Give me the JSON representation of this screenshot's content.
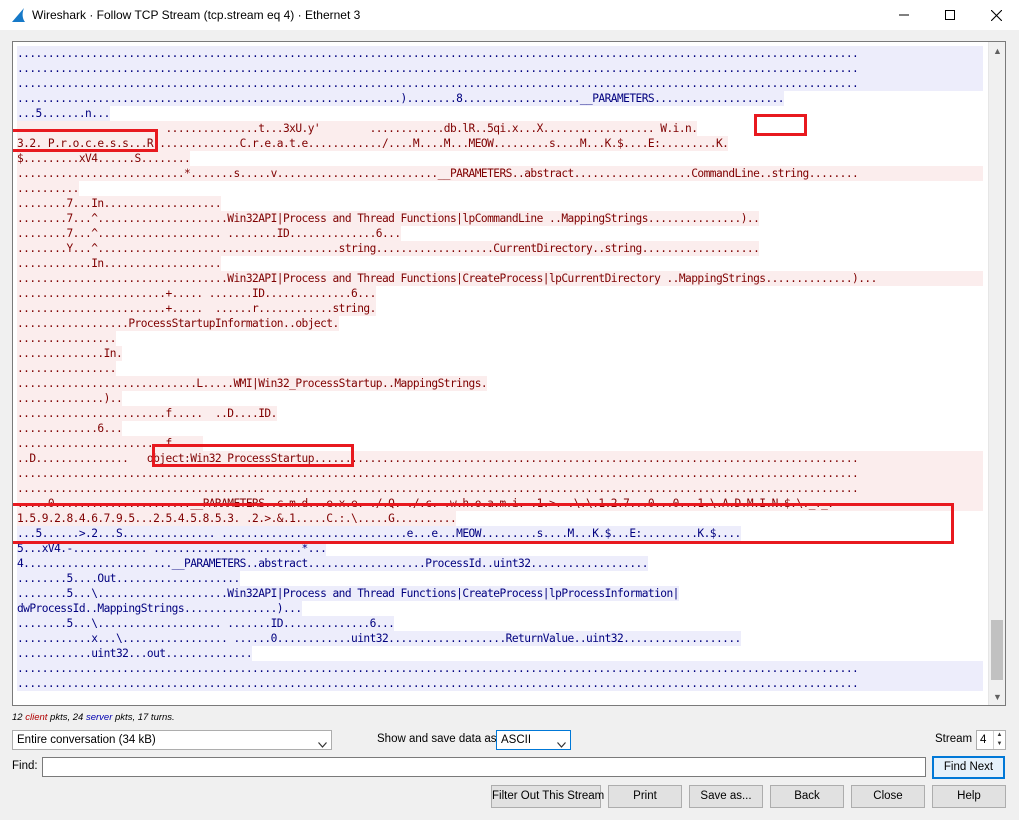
{
  "window": {
    "title": "Wireshark · Follow TCP Stream (tcp.stream eq 4) · Ethernet 3",
    "minimize_icon": "minimize-icon",
    "maximize_icon": "maximize-icon",
    "close_icon": "close-icon"
  },
  "colors": {
    "client_bg": "#fbeded",
    "client_fg": "#7f0000",
    "server_bg": "#ededfb",
    "server_fg": "#00007f",
    "highlight": "#e8191f"
  },
  "stream_lines": [
    {
      "side": "server",
      "full": true,
      "text": "........................................................................................................................................"
    },
    {
      "side": "server",
      "full": true,
      "text": "........................................................................................................................................"
    },
    {
      "side": "server",
      "full": true,
      "text": "........................................................................................................................................"
    },
    {
      "side": "server",
      "full": false,
      "text": "..............................................................)........8...................__PARAMETERS....................."
    },
    {
      "side": "server",
      "full": false,
      "text": "...5.......n..."
    },
    {
      "side": "client",
      "full": false,
      "text": "..................      ...............t...3xU.y'        ............db.lR..5qi.x...X.................. W.i.n."
    },
    {
      "side": "client",
      "full": false,
      "text": "3.2._P.r.o.c.e.s.s...R..............C.r.e.a.t.e............/....M....M...MEOW.........s....M...K.$....E:.........K."
    },
    {
      "side": "client",
      "full": false,
      "text": "$.........xV4......S........"
    },
    {
      "side": "client",
      "full": true,
      "text": "...........................*.......s.....v..........................__PARAMETERS..abstract...................CommandLine..string........"
    },
    {
      "side": "client",
      "full": false,
      "text": ".........."
    },
    {
      "side": "client",
      "full": false,
      "text": "........7...In..................."
    },
    {
      "side": "client",
      "full": false,
      "text": "........7...^.....................Win32API|Process and Thread Functions|lpCommandLine ..MappingStrings...............).."
    },
    {
      "side": "client",
      "full": false,
      "text": "........7...^.................... ........ID..............6..."
    },
    {
      "side": "client",
      "full": false,
      "text": "........Y...^.......................................string...................CurrentDirectory..string..................."
    },
    {
      "side": "client",
      "full": false,
      "text": "............In..................."
    },
    {
      "side": "client",
      "full": true,
      "text": "..................................Win32API|Process and Thread Functions|CreateProcess|lpCurrentDirectory ..MappingStrings..............)..."
    },
    {
      "side": "client",
      "full": false,
      "text": "........................+..... .......ID..............6..."
    },
    {
      "side": "client",
      "full": false,
      "text": "........................+.....  ......r............string."
    },
    {
      "side": "client",
      "full": false,
      "text": "..................ProcessStartupInformation..object."
    },
    {
      "side": "client",
      "full": false,
      "text": "................"
    },
    {
      "side": "client",
      "full": false,
      "text": "..............In."
    },
    {
      "side": "client",
      "full": false,
      "text": "................"
    },
    {
      "side": "client",
      "full": false,
      "text": ".............................L.....WMI|Win32_ProcessStartup..MappingStrings."
    },
    {
      "side": "client",
      "full": false,
      "text": "..............).."
    },
    {
      "side": "client",
      "full": false,
      "text": "........................f.....  ..D....ID."
    },
    {
      "side": "client",
      "full": false,
      "text": ".............6..."
    },
    {
      "side": "client",
      "full": false,
      "text": "........................f....."
    },
    {
      "side": "client",
      "full": true,
      "text": "..D...............   object:Win32_ProcessStartup........................................................................................"
    },
    {
      "side": "client",
      "full": true,
      "text": "........................................................................................................................................"
    },
    {
      "side": "client",
      "full": true,
      "text": "........................................................................................................................................"
    },
    {
      "side": "client",
      "full": true,
      "text": ".....0......................__PARAMETERS..c.m.d...e.x.e. ./.Q. ./.c. .w.h.o.a.m.i. .1.>. .\\.\\.1.2.7...0...0...1.\\.A.D.M.I.N.$.\\._._."
    },
    {
      "side": "client",
      "full": false,
      "text": "1.5.9.2.8.4.6.7.9.5...2.5.4.5.8.5.3. .2.>.&.1.....C.:.\\.....G.........."
    },
    {
      "side": "server",
      "full": false,
      "text": "...5......>.2...S............... ..............................e...e...MEOW.........s....M...K.$...E:.........K.$...."
    },
    {
      "side": "server",
      "full": false,
      "text": "5...xV4.-............ ........................*..."
    },
    {
      "side": "server",
      "full": false,
      "text": "4........................__PARAMETERS..abstract...................ProcessId..uint32..................."
    },
    {
      "side": "server",
      "full": false,
      "text": "........5....Out...................."
    },
    {
      "side": "server",
      "full": false,
      "text": "........5...\\.....................Win32API|Process and Thread Functions|CreateProcess|lpProcessInformation|"
    },
    {
      "side": "server",
      "full": false,
      "text": "dwProcessId..MappingStrings...............)..."
    },
    {
      "side": "server",
      "full": false,
      "text": "........5...\\.................... .......ID..............6..."
    },
    {
      "side": "server",
      "full": false,
      "text": "............x...\\................. ......0............uint32...................ReturnValue..uint32..................."
    },
    {
      "side": "server",
      "full": false,
      "text": "............uint32...out.............."
    },
    {
      "side": "server",
      "full": true,
      "text": "........................................................................................................................................"
    },
    {
      "side": "server",
      "full": true,
      "text": "........................................................................................................................................"
    }
  ],
  "scroll": {
    "up_icon": "scroll-up-icon",
    "down_icon": "scroll-down-icon"
  },
  "stats": {
    "client_count": "12",
    "client_word": "client",
    "middle": "pkts,",
    "server_count": "24",
    "server_word": "server",
    "tail": "pkts, 17 turns."
  },
  "conversation_select": {
    "value": "Entire conversation (34 kB)"
  },
  "show_save_label": "Show and save data as",
  "format_select": {
    "value": "ASCII"
  },
  "stream_label": "Stream",
  "stream_value": "4",
  "find": {
    "label": "Find:",
    "value": "",
    "button": "Find Next"
  },
  "buttons": {
    "filter_out": "Filter Out This Stream",
    "print": "Print",
    "save_as": "Save as...",
    "back": "Back",
    "close": "Close",
    "help": "Help"
  }
}
